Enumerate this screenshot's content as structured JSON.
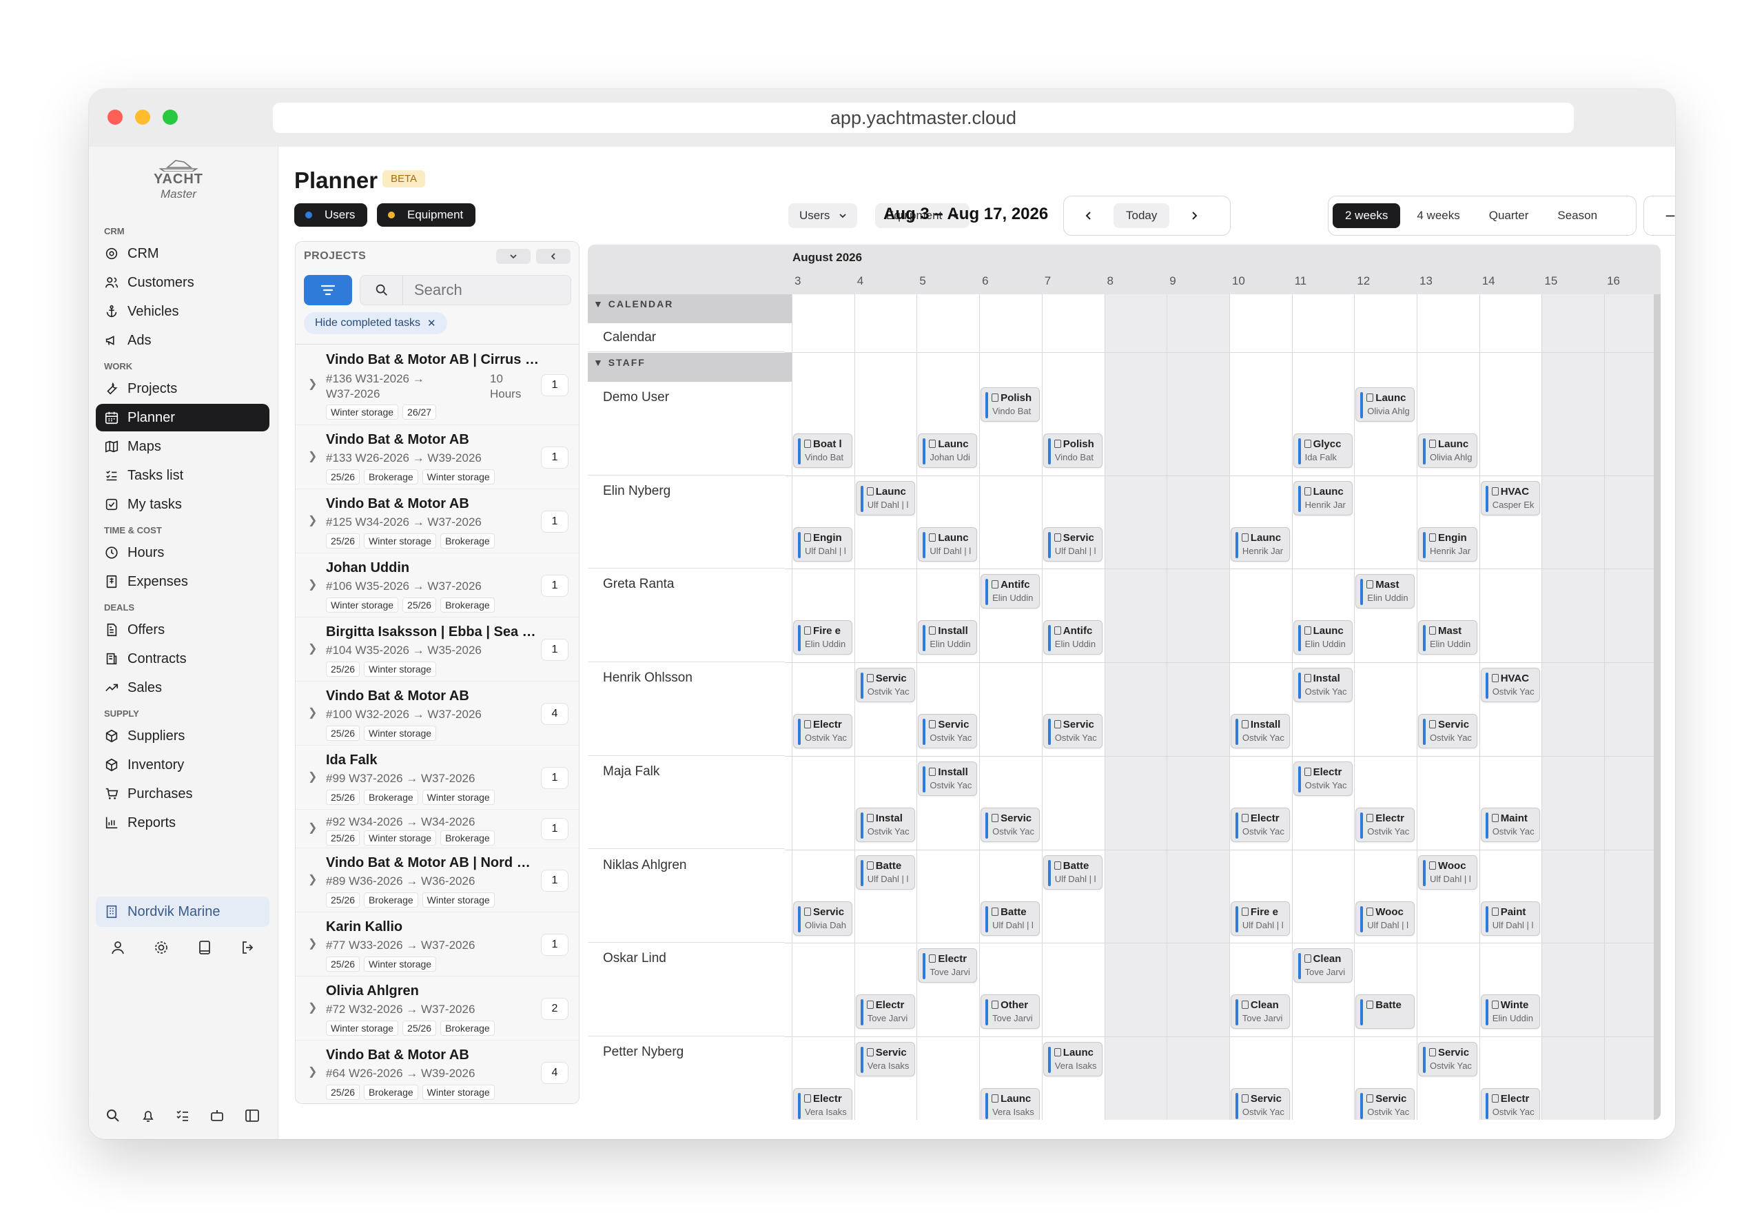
{
  "window": {
    "url": "app.yachtmaster.cloud"
  },
  "logo": {
    "line1": "YACHT",
    "line2": "Master"
  },
  "sidebar": {
    "sections": [
      {
        "label": "CRM",
        "items": [
          {
            "label": "CRM",
            "icon": "target-icon"
          },
          {
            "label": "Customers",
            "icon": "users-icon"
          },
          {
            "label": "Vehicles",
            "icon": "anchor-icon"
          },
          {
            "label": "Ads",
            "icon": "megaphone-icon"
          }
        ]
      },
      {
        "label": "WORK",
        "items": [
          {
            "label": "Projects",
            "icon": "wrench-icon"
          },
          {
            "label": "Planner",
            "icon": "calendar-icon",
            "active": true
          },
          {
            "label": "Maps",
            "icon": "map-icon"
          },
          {
            "label": "Tasks list",
            "icon": "list-check-icon"
          },
          {
            "label": "My tasks",
            "icon": "checkbox-icon"
          }
        ]
      },
      {
        "label": "TIME & COST",
        "items": [
          {
            "label": "Hours",
            "icon": "clock-icon"
          },
          {
            "label": "Expenses",
            "icon": "receipt-icon"
          }
        ]
      },
      {
        "label": "DEALS",
        "items": [
          {
            "label": "Offers",
            "icon": "file-icon"
          },
          {
            "label": "Contracts",
            "icon": "contract-icon"
          },
          {
            "label": "Sales",
            "icon": "trend-icon"
          }
        ]
      },
      {
        "label": "SUPPLY",
        "items": [
          {
            "label": "Suppliers",
            "icon": "truck-icon"
          },
          {
            "label": "Inventory",
            "icon": "box-icon"
          },
          {
            "label": "Purchases",
            "icon": "cart-icon"
          },
          {
            "label": "Reports",
            "icon": "chart-icon"
          }
        ]
      }
    ],
    "org": "Nordvik Marine"
  },
  "header": {
    "title": "Planner",
    "badge": "BETA",
    "resource_toggles": [
      {
        "label": "Users",
        "dot": "#2e7bd9"
      },
      {
        "label": "Equipment",
        "dot": "#f0b429"
      }
    ],
    "dropdowns": [
      {
        "label": "Users"
      },
      {
        "label": "Equipment"
      }
    ],
    "date_range": "Aug 3 – Aug 17, 2026",
    "today_label": "Today",
    "ranges": [
      {
        "label": "2 weeks",
        "active": true
      },
      {
        "label": "4 weeks"
      },
      {
        "label": "Quarter"
      },
      {
        "label": "Season"
      }
    ],
    "zoom_out": "−",
    "zoom_in": "+"
  },
  "projects_panel": {
    "heading": "PROJECTS",
    "search_placeholder": "Search",
    "filter_chip": "Hide completed tasks",
    "items": [
      {
        "name": "Vindo Bat & Motor AB | Cirrus | ...",
        "sub": "#136  W31-2026 → W37-2026",
        "hours": "10 Hours",
        "tags": [
          "Winter storage",
          "26/27"
        ],
        "count": "1"
      },
      {
        "name": "Vindo Bat & Motor AB",
        "sub": "#133  W26-2026 → W39-2026",
        "tags": [
          "25/26",
          "Brokerage",
          "Winter storage"
        ],
        "count": "1"
      },
      {
        "name": "Vindo Bat & Motor AB",
        "sub": "#125  W34-2026 → W37-2026",
        "tags": [
          "25/26",
          "Winter storage",
          "Brokerage"
        ],
        "count": "1"
      },
      {
        "name": "Johan Uddin",
        "sub": "#106  W35-2026 → W37-2026",
        "tags": [
          "Winter storage",
          "25/26",
          "Brokerage"
        ],
        "count": "1"
      },
      {
        "name": "Birgitta Isaksson | Ebba | Sea Ra...",
        "sub": "#104  W35-2026 → W35-2026",
        "tags": [
          "25/26",
          "Winter storage"
        ],
        "count": "1"
      },
      {
        "name": "Vindo Bat & Motor AB",
        "sub": "#100  W32-2026 → W37-2026",
        "tags": [
          "25/26",
          "Winter storage"
        ],
        "count": "4"
      },
      {
        "name": "Ida Falk",
        "sub": "#99  W37-2026 → W37-2026",
        "tags": [
          "25/26",
          "Brokerage",
          "Winter storage"
        ],
        "count": "1"
      },
      {
        "name": "",
        "sub": "#92  W34-2026 → W34-2026",
        "tags": [
          "25/26",
          "Winter storage",
          "Brokerage"
        ],
        "count": "1"
      },
      {
        "name": "Vindo Bat & Motor AB | Nord St...",
        "sub": "#89  W36-2026 → W36-2026",
        "tags": [
          "25/26",
          "Brokerage",
          "Winter storage"
        ],
        "count": "1"
      },
      {
        "name": "Karin Kallio",
        "sub": "#77  W33-2026 → W37-2026",
        "tags": [
          "25/26",
          "Winter storage"
        ],
        "count": "1"
      },
      {
        "name": "Olivia Ahlgren",
        "sub": "#72  W32-2026 → W37-2026",
        "tags": [
          "Winter storage",
          "25/26",
          "Brokerage"
        ],
        "count": "2"
      },
      {
        "name": "Vindo Bat & Motor AB",
        "sub": "#64  W26-2026 → W39-2026",
        "tags": [
          "25/26",
          "Brokerage",
          "Winter storage"
        ],
        "count": "4"
      }
    ]
  },
  "grid": {
    "month": "August 2026",
    "days": [
      "3",
      "4",
      "5",
      "6",
      "7",
      "8",
      "9",
      "10",
      "11",
      "12",
      "13",
      "14",
      "15",
      "16"
    ],
    "weekend_days": [
      "8",
      "9",
      "15",
      "16"
    ],
    "sections": [
      {
        "label": "CALENDAR"
      },
      {
        "label": "STAFF"
      }
    ],
    "calendar_row": "Calendar",
    "rows": [
      {
        "name": "Demo User",
        "tasks": [
          {
            "day": "6",
            "lane": 0,
            "t1": "Polish",
            "t2": "Vindo Bat"
          },
          {
            "day": "12",
            "lane": 0,
            "t1": "Launc",
            "t2": "Olivia Ahlg"
          },
          {
            "day": "3",
            "lane": 1,
            "t1": "Boat l",
            "t2": "Vindo Bat"
          },
          {
            "day": "5",
            "lane": 1,
            "t1": "Launc",
            "t2": "Johan Udi"
          },
          {
            "day": "7",
            "lane": 1,
            "t1": "Polish",
            "t2": "Vindo Bat"
          },
          {
            "day": "11",
            "lane": 1,
            "t1": "Glycc",
            "t2": "Ida Falk"
          },
          {
            "day": "13",
            "lane": 1,
            "t1": "Launc",
            "t2": "Olivia Ahlg"
          }
        ]
      },
      {
        "name": "Elin Nyberg",
        "tasks": [
          {
            "day": "4",
            "lane": 0,
            "t1": "Launc",
            "t2": "Ulf Dahl | l"
          },
          {
            "day": "11",
            "lane": 0,
            "t1": "Launc",
            "t2": "Henrik Jar"
          },
          {
            "day": "14",
            "lane": 0,
            "t1": "HVAC",
            "t2": "Casper Ek"
          },
          {
            "day": "3",
            "lane": 1,
            "t1": "Engin",
            "t2": "Ulf Dahl | l"
          },
          {
            "day": "5",
            "lane": 1,
            "t1": "Launc",
            "t2": "Ulf Dahl | l"
          },
          {
            "day": "7",
            "lane": 1,
            "t1": "Servic",
            "t2": "Ulf Dahl | l"
          },
          {
            "day": "10",
            "lane": 1,
            "t1": "Launc",
            "t2": "Henrik Jar"
          },
          {
            "day": "13",
            "lane": 1,
            "t1": "Engin",
            "t2": "Henrik Jar"
          }
        ]
      },
      {
        "name": "Greta Ranta",
        "tasks": [
          {
            "day": "6",
            "lane": 0,
            "t1": "Antifc",
            "t2": "Elin Uddin"
          },
          {
            "day": "12",
            "lane": 0,
            "t1": "Mast",
            "t2": "Elin Uddin"
          },
          {
            "day": "3",
            "lane": 1,
            "t1": "Fire e",
            "t2": "Elin Uddin"
          },
          {
            "day": "5",
            "lane": 1,
            "t1": "Install",
            "t2": "Elin Uddin"
          },
          {
            "day": "7",
            "lane": 1,
            "t1": "Antifc",
            "t2": "Elin Uddin"
          },
          {
            "day": "11",
            "lane": 1,
            "t1": "Launc",
            "t2": "Elin Uddin"
          },
          {
            "day": "13",
            "lane": 1,
            "t1": "Mast",
            "t2": "Elin Uddin"
          }
        ]
      },
      {
        "name": "Henrik Ohlsson",
        "tasks": [
          {
            "day": "4",
            "lane": 0,
            "t1": "Servic",
            "t2": "Ostvik Yac"
          },
          {
            "day": "11",
            "lane": 0,
            "t1": "Instal",
            "t2": "Ostvik Yac"
          },
          {
            "day": "14",
            "lane": 0,
            "t1": "HVAC",
            "t2": "Ostvik Yac"
          },
          {
            "day": "3",
            "lane": 1,
            "t1": "Electr",
            "t2": "Ostvik Yac"
          },
          {
            "day": "5",
            "lane": 1,
            "t1": "Servic",
            "t2": "Ostvik Yac"
          },
          {
            "day": "7",
            "lane": 1,
            "t1": "Servic",
            "t2": "Ostvik Yac"
          },
          {
            "day": "10",
            "lane": 1,
            "t1": "Install",
            "t2": "Ostvik Yac"
          },
          {
            "day": "13",
            "lane": 1,
            "t1": "Servic",
            "t2": "Ostvik Yac"
          }
        ]
      },
      {
        "name": "Maja Falk",
        "tasks": [
          {
            "day": "5",
            "lane": 0,
            "t1": "Install",
            "t2": "Ostvik Yac"
          },
          {
            "day": "11",
            "lane": 0,
            "t1": "Electr",
            "t2": "Ostvik Yac"
          },
          {
            "day": "4",
            "lane": 1,
            "t1": "Instal",
            "t2": "Ostvik Yac"
          },
          {
            "day": "6",
            "lane": 1,
            "t1": "Servic",
            "t2": "Ostvik Yac"
          },
          {
            "day": "10",
            "lane": 1,
            "t1": "Electr",
            "t2": "Ostvik Yac"
          },
          {
            "day": "12",
            "lane": 1,
            "t1": "Electr",
            "t2": "Ostvik Yac"
          },
          {
            "day": "14",
            "lane": 1,
            "t1": "Maint",
            "t2": "Ostvik Yac"
          }
        ]
      },
      {
        "name": "Niklas Ahlgren",
        "tasks": [
          {
            "day": "4",
            "lane": 0,
            "t1": "Batte",
            "t2": "Ulf Dahl | l"
          },
          {
            "day": "7",
            "lane": 0,
            "t1": "Batte",
            "t2": "Ulf Dahl | l"
          },
          {
            "day": "13",
            "lane": 0,
            "t1": "Wooc",
            "t2": "Ulf Dahl | l"
          },
          {
            "day": "3",
            "lane": 1,
            "t1": "Servic",
            "t2": "Olivia Dah"
          },
          {
            "day": "6",
            "lane": 1,
            "t1": "Batte",
            "t2": "Ulf Dahl | l"
          },
          {
            "day": "10",
            "lane": 1,
            "t1": "Fire e",
            "t2": "Ulf Dahl | l"
          },
          {
            "day": "12",
            "lane": 1,
            "t1": "Wooc",
            "t2": "Ulf Dahl | l"
          },
          {
            "day": "14",
            "lane": 1,
            "t1": "Paint",
            "t2": "Ulf Dahl | l"
          }
        ]
      },
      {
        "name": "Oskar Lind",
        "tasks": [
          {
            "day": "5",
            "lane": 0,
            "t1": "Electr",
            "t2": "Tove Jarvi"
          },
          {
            "day": "11",
            "lane": 0,
            "t1": "Clean",
            "t2": "Tove Jarvi"
          },
          {
            "day": "4",
            "lane": 1,
            "t1": "Electr",
            "t2": "Tove Jarvi"
          },
          {
            "day": "6",
            "lane": 1,
            "t1": "Other",
            "t2": "Tove Jarvi"
          },
          {
            "day": "10",
            "lane": 1,
            "t1": "Clean",
            "t2": "Tove Jarvi"
          },
          {
            "day": "12",
            "lane": 1,
            "t1": "Batte",
            "t2": ""
          },
          {
            "day": "14",
            "lane": 1,
            "t1": "Winte",
            "t2": "Elin Uddin"
          }
        ]
      },
      {
        "name": "Petter Nyberg",
        "tasks": [
          {
            "day": "4",
            "lane": 0,
            "t1": "Servic",
            "t2": "Vera Isaks"
          },
          {
            "day": "7",
            "lane": 0,
            "t1": "Launc",
            "t2": "Vera Isaks"
          },
          {
            "day": "13",
            "lane": 0,
            "t1": "Servic",
            "t2": "Ostvik Yac"
          },
          {
            "day": "3",
            "lane": 1,
            "t1": "Electr",
            "t2": "Vera Isaks"
          },
          {
            "day": "6",
            "lane": 1,
            "t1": "Launc",
            "t2": "Vera Isaks"
          },
          {
            "day": "10",
            "lane": 1,
            "t1": "Servic",
            "t2": "Ostvik Yac"
          },
          {
            "day": "12",
            "lane": 1,
            "t1": "Servic",
            "t2": "Ostvik Yac"
          },
          {
            "day": "14",
            "lane": 1,
            "t1": "Electr",
            "t2": "Ostvik Yac"
          }
        ]
      }
    ]
  }
}
